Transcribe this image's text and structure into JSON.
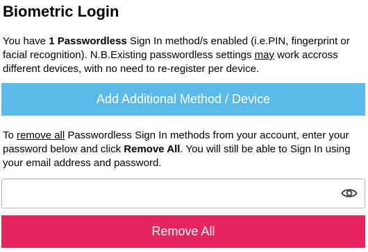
{
  "page": {
    "title": "Biometric Login"
  },
  "intro": {
    "part1": "You have ",
    "count_bold": "1 Passwordless",
    "part2": " Sign In method/s enabled (i.e.PIN, fingerprint or facial recognition). N.B.Existing passwordless settings ",
    "may_underlined": "may",
    "part3": " work accross different devices, with no need to re-register per device."
  },
  "add_button": {
    "label": "Add Additional Method / Device",
    "color": "#5bbbe8"
  },
  "remove_instructions": {
    "part1": "To ",
    "remove_all_underlined": "remove all",
    "part2": " Passwordless Sign In methods from your account, enter your password below and click ",
    "remove_all_bold": "Remove All",
    "part3": ". You will still be able to Sign In using your email address and password."
  },
  "password_field": {
    "value": "",
    "placeholder": "",
    "toggle_icon": "eye-icon"
  },
  "remove_button": {
    "label": "Remove All",
    "color": "#e5255f"
  }
}
